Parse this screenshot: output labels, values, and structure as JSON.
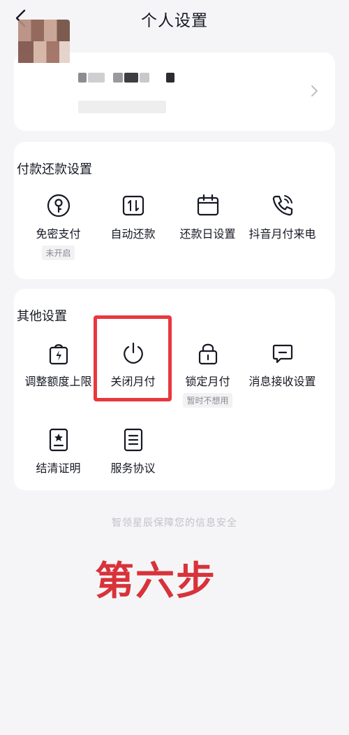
{
  "header": {
    "title": "个人设置"
  },
  "payment": {
    "title": "付款还款设置",
    "items": [
      {
        "label": "免密支付",
        "icon": "key-circle-icon",
        "badge": "未开启"
      },
      {
        "label": "自动还款",
        "icon": "auto-repay-icon"
      },
      {
        "label": "还款日设置",
        "icon": "calendar-icon"
      },
      {
        "label": "抖音月付来电",
        "icon": "phone-call-icon"
      }
    ]
  },
  "other": {
    "title": "其他设置",
    "items": [
      {
        "label": "调整额度上限",
        "icon": "bag-lightning-icon"
      },
      {
        "label": "关闭月付",
        "icon": "power-icon"
      },
      {
        "label": "锁定月付",
        "icon": "lock-icon",
        "badge": "暂时不想用"
      },
      {
        "label": "消息接收设置",
        "icon": "message-icon"
      },
      {
        "label": "结清证明",
        "icon": "certificate-icon"
      },
      {
        "label": "服务协议",
        "icon": "document-icon"
      }
    ]
  },
  "footer": {
    "note": "智领星辰保障您的信息安全"
  },
  "annotation": {
    "step": "第六步"
  },
  "colors": {
    "highlight": "#e8383d",
    "step_text": "#d8323a"
  }
}
